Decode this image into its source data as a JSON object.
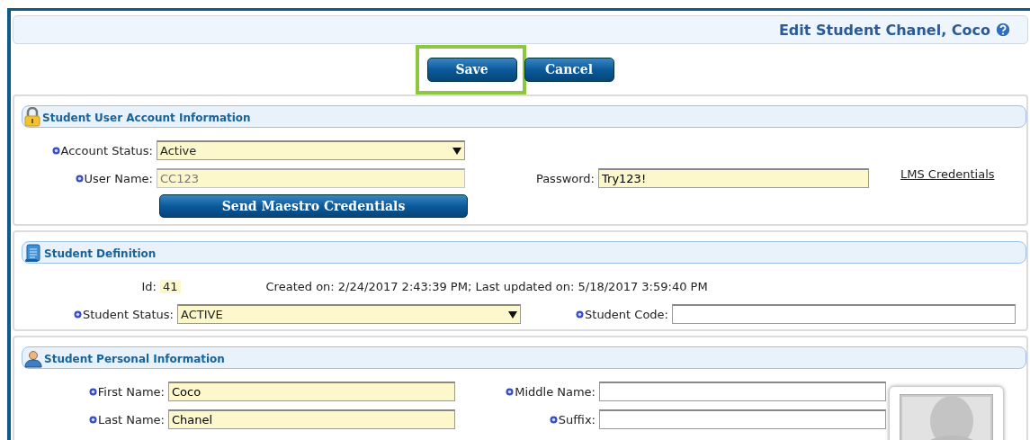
{
  "header": {
    "title": "Edit Student Chanel, Coco"
  },
  "buttons": [
    {
      "label": "Save",
      "highlighted": true
    },
    {
      "label": "Cancel",
      "highlighted": false
    }
  ],
  "sections": [
    {
      "title": "Student User Account Information",
      "rows": [
        [
          {
            "kind": "select",
            "label": "Account Status:",
            "value": "Active",
            "required": true,
            "filled": true,
            "disabled": false
          }
        ],
        [
          {
            "kind": "input",
            "label": "User Name:",
            "value": "CC123",
            "required": true,
            "filled": true,
            "disabled": true
          },
          {
            "kind": "input",
            "label": "Password:",
            "value": "Try123!",
            "required": false,
            "filled": true,
            "disabled": false
          },
          {
            "kind": "link",
            "label": "LMS Credentials"
          }
        ],
        [
          {
            "kind": "button",
            "label": "Send Maestro Credentials"
          }
        ]
      ]
    },
    {
      "title": "Student Definition",
      "rows": [
        [
          {
            "kind": "info",
            "label": "Id:",
            "value": "41"
          },
          {
            "kind": "text",
            "label": "Created on: 2/24/2017 2:43:39 PM; Last updated on: 5/18/2017 3:59:40 PM"
          }
        ],
        [
          {
            "kind": "select",
            "label": "Student Status:",
            "value": "ACTIVE",
            "required": true,
            "filled": true,
            "disabled": false
          },
          {
            "kind": "input",
            "label": "Student Code:",
            "required": true,
            "filled": false,
            "disabled": false
          }
        ]
      ]
    },
    {
      "title": "Student Personal Information",
      "photo": {
        "kind": "picture"
      },
      "rows": [
        [
          {
            "kind": "input",
            "label": "First Name:",
            "value": "Coco",
            "required": true,
            "filled": true,
            "disabled": false
          },
          {
            "kind": "input",
            "label": "Middle Name:",
            "required": true,
            "filled": false,
            "disabled": false
          }
        ],
        [
          {
            "kind": "input",
            "label": "Last Name:",
            "value": "Chanel",
            "required": true,
            "filled": true,
            "disabled": false
          },
          {
            "kind": "input",
            "label": "Suffix:",
            "required": true,
            "filled": false,
            "disabled": false
          }
        ]
      ]
    }
  ]
}
